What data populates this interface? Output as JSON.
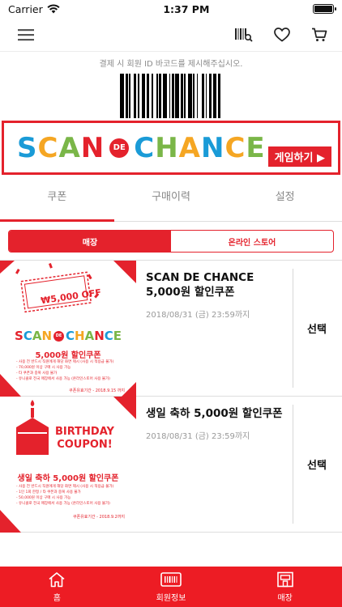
{
  "status": {
    "carrier": "Carrier",
    "time": "1:37 PM"
  },
  "nav": {
    "menu_icon": "hamburger-icon",
    "barcode_icon": "barcode-search-icon",
    "heart_icon": "heart-icon",
    "cart_icon": "cart-icon"
  },
  "barcode": {
    "hint": "결제 시 회원 ID 바코드를 제시해주십시오."
  },
  "banner": {
    "title_1": "SCAN",
    "title_de": "DE",
    "title_2": "CHANCE",
    "button": "게임하기 ▶"
  },
  "tabs": [
    {
      "label": "쿠폰",
      "active": true
    },
    {
      "label": "구매이력",
      "active": false
    },
    {
      "label": "설정",
      "active": false
    }
  ],
  "segment": [
    {
      "label": "매장",
      "active": true
    },
    {
      "label": "온라인 스토어",
      "active": false
    }
  ],
  "coupons": [
    {
      "name": "SCAN DE CHANCE 5,000원 할인쿠폰",
      "expiry": "2018/08/31 (금) 23:59까지",
      "action": "선택",
      "thumb": {
        "ticket": "₩5,000 OFF",
        "title_1": "SCAN",
        "title_de": "DE",
        "title_2": "CHANCE",
        "subtitle": "5,000원 할인쿠폰",
        "notes": [
          "- 사용 전 반드시 직원에게 해당 화면 제시 (사용 시 적용급 불가)",
          "- 70,000원 이상 구매 시 사용 가능",
          "- 타 쿠폰과 중복 사용 불가",
          "- 유니클로 전국 매장에서 사용 가능 (온라인스토어 사용 불가)"
        ],
        "footer": "쿠폰유효기간 - 2018.9.15 까지"
      }
    },
    {
      "name": "생일 축하 5,000원 할인쿠폰",
      "expiry": "2018/08/31 (금) 23:59까지",
      "action": "선택",
      "thumb": {
        "title_1": "BIRTHDAY",
        "title_2": "COUPON!",
        "subtitle": "생일 축하 5,000원 할인쿠폰",
        "notes": [
          "- 사용 전 반드시 직원에게 해당 화면 제시 (사용 시 적용급 불가)",
          "- 1인 1회 한정 / 타 쿠폰과 중복 사용 불가",
          "- 50,000원 이상 구매 시 사용 가능",
          "- 유니클로 전국 매장에서 사용 가능 (온라인스토어 사용 불가)"
        ],
        "footer": "쿠폰유효기간 - 2018.9.2까지"
      }
    }
  ],
  "tabbar": [
    {
      "label": "홈",
      "icon": "home-icon"
    },
    {
      "label": "회원정보",
      "icon": "member-card-icon"
    },
    {
      "label": "매장",
      "icon": "store-icon"
    }
  ],
  "colors": {
    "accent": "#e4222c",
    "tabbar": "#ed1c24"
  }
}
